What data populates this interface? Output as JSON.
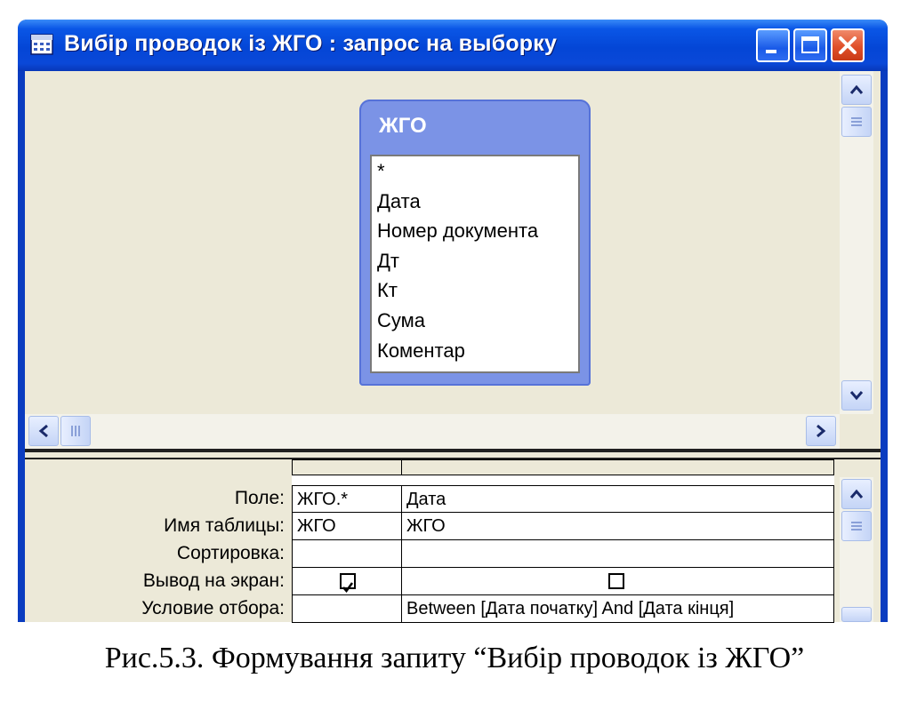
{
  "window": {
    "title": "Вибір проводок із ЖГО : запрос на выборку"
  },
  "table_box": {
    "name": "ЖГО",
    "fields": [
      "*",
      "Дата",
      "Номер документа",
      "Дт",
      "Кт",
      "Сума",
      "Коментар"
    ]
  },
  "design_grid": {
    "row_labels": [
      "Поле:",
      "Имя таблицы:",
      "Сортировка:",
      "Вывод на экран:",
      "Условие отбора:"
    ],
    "columns": [
      {
        "field": "ЖГО.*",
        "table": "ЖГО",
        "sort": "",
        "show": true,
        "criteria": ""
      },
      {
        "field": "Дата",
        "table": "ЖГО",
        "sort": "",
        "show": false,
        "criteria": "Between [Дата початку] And [Дата кінця]"
      }
    ]
  },
  "caption": "Рис.5.3. Формування запиту “Вибір проводок із ЖГО”",
  "colors": {
    "titlebar": "#0a56e6",
    "close_button": "#e0502a",
    "table_header": "#7b93e6",
    "client_bg": "#ece9d8"
  },
  "icons": {
    "app": "query-design-icon",
    "minimize": "minimize-icon",
    "maximize": "maximize-icon",
    "close": "close-icon"
  }
}
